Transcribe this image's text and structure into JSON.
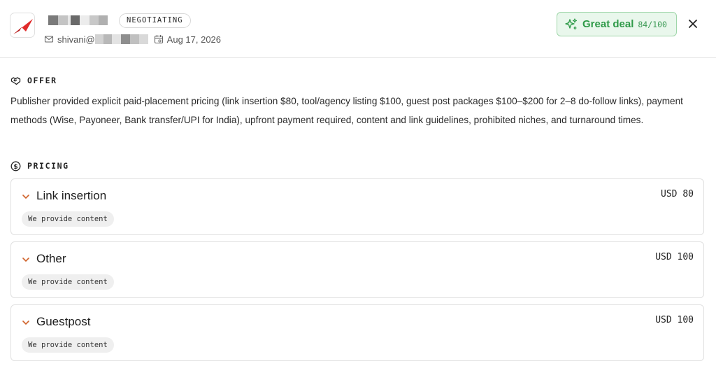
{
  "header": {
    "status": "NEGOTIATING",
    "email_prefix": "shivani@",
    "date": "Aug 17, 2026",
    "deal": {
      "label": "Great deal",
      "score": "84/100"
    },
    "icons": {
      "logo": "brand-logo",
      "email": "mail-icon",
      "date": "calendar-icon",
      "deal": "sparkle-icon",
      "close": "close-icon"
    }
  },
  "offer": {
    "heading": "OFFER",
    "icon": "handshake-icon",
    "text": "Publisher provided explicit paid-placement pricing (link insertion $80, tool/agency listing $100, guest post packages $100–$200 for 2–8 do-follow links), payment methods (Wise, Payoneer, Bank transfer/UPI for India), upfront payment required, content and link guidelines, prohibited niches, and turnaround times."
  },
  "pricing": {
    "heading": "PRICING",
    "icon": "dollar-circle-icon",
    "items": [
      {
        "name": "Link insertion",
        "price": "USD 80",
        "tag": "We provide content"
      },
      {
        "name": "Other",
        "price": "USD 100",
        "tag": "We provide content"
      },
      {
        "name": "Guestpost",
        "price": "USD 100",
        "tag": "We provide content"
      }
    ]
  },
  "colors": {
    "accent_green": "#2e9a48",
    "badge_bg": "#e9f7ec",
    "chevron": "#d0632b",
    "logo_red": "#e02a2a"
  }
}
